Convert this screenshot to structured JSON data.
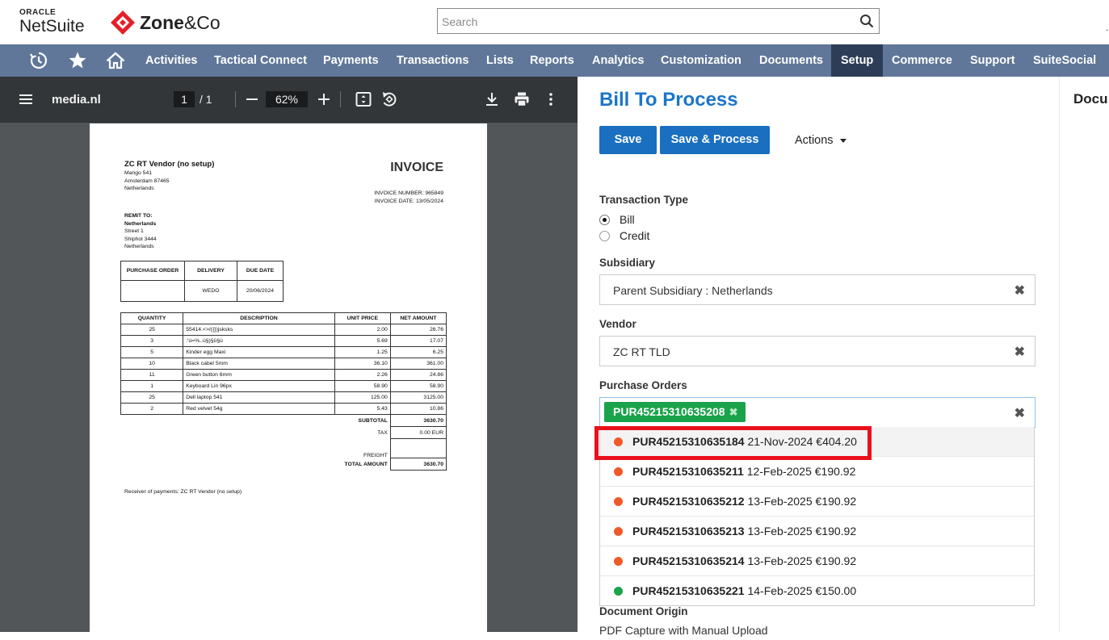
{
  "header": {
    "oracle_text": "ORACLE",
    "netsuite_text": "NetSuite",
    "zone_brand_bold": "Zone",
    "zone_brand_rest": "&Co",
    "search_placeholder": "Search"
  },
  "nav": {
    "icons": [
      "recent-icon",
      "star-icon",
      "home-icon"
    ],
    "items": [
      "Activities",
      "Tactical Connect",
      "Payments",
      "Transactions",
      "Lists",
      "Reports",
      "Analytics",
      "Customization",
      "Documents",
      "Setup",
      "Commerce",
      "Support",
      "SuiteSocial"
    ],
    "active": "Setup",
    "bg_color": "#607799",
    "active_color": "#2e3d57"
  },
  "pdf_viewer": {
    "filename": "media.nl",
    "page_current": "1",
    "page_total": "/ 1",
    "zoom": "62%",
    "invoice": {
      "vendor_name": "ZC RT Vendor (no setup)",
      "vendor_address": [
        "Mango 541",
        "Amsterdam 87465",
        "Netherlands"
      ],
      "title": "INVOICE",
      "invoice_number": "INVOICE NUMBER: 965849",
      "invoice_date": "INVOICE DATE: 13/05/2024",
      "remit_label": "REMIT TO:",
      "remit_name": "Netherlands",
      "remit_address": [
        "Street 1",
        "Shiphol 3444",
        "Netherlands"
      ],
      "po_headers": [
        "PURCHASE ORDER",
        "DELIVERY",
        "DUE DATE"
      ],
      "po_row": [
        "",
        "WEDO",
        "20/06/2024"
      ],
      "item_headers": [
        "QUANTITY",
        "DESCRIPTION",
        "UNIT PRICE",
        "NET AMOUNT"
      ],
      "items": [
        [
          "25",
          "55414.<>/({})jsksks",
          "2.00",
          "26.76"
        ],
        [
          "3",
          ":'ù=%..ù§)§û§ù",
          "5.69",
          "17.07"
        ],
        [
          "5",
          "Kinder egg Maxi",
          "1.25",
          "6.25"
        ],
        [
          "10",
          "Black cabel 5mm",
          "36.10",
          "361.00"
        ],
        [
          "11",
          "Green button 6mm",
          "2.26",
          "24.86"
        ],
        [
          "1",
          "Keyboard Lin 96px",
          "58.90",
          "58.90"
        ],
        [
          "25",
          "Dell laptop 541",
          "125.00",
          "3125.00"
        ],
        [
          "2",
          "Red velvet 54g",
          "5.43",
          "10.86"
        ]
      ],
      "subtotal_label": "SUBTOTAL",
      "subtotal_value": "3630.70",
      "tax_label": "TAX",
      "tax_value": "0.00 EUR",
      "freight_label": "FREIGHT",
      "freight_value": "",
      "total_label": "TOTAL AMOUNT",
      "total_value": "3630.70",
      "receiver": "Receiver of payments: ZC RT Vendor (no setup)"
    }
  },
  "form": {
    "title": "Bill To Process",
    "save_label": "Save",
    "save_process_label": "Save & Process",
    "actions_label": "Actions",
    "transaction_type_label": "Transaction Type",
    "transaction_types": [
      {
        "label": "Bill",
        "selected": true
      },
      {
        "label": "Credit",
        "selected": false
      }
    ],
    "subsidiary_label": "Subsidiary",
    "subsidiary_value": "Parent Subsidiary : Netherlands",
    "vendor_label": "Vendor",
    "vendor_value": "ZC RT TLD",
    "purchase_orders_label": "Purchase Orders",
    "selected_po": "PUR45215310635208",
    "po_options": [
      {
        "id": "PUR45215310635184",
        "details": "21-Nov-2024 €404.20",
        "status_color": "#f05a28",
        "highlighted": true
      },
      {
        "id": "PUR45215310635211",
        "details": "12-Feb-2025 €190.92",
        "status_color": "#f05a28",
        "highlighted": false
      },
      {
        "id": "PUR45215310635212",
        "details": "13-Feb-2025 €190.92",
        "status_color": "#f05a28",
        "highlighted": false
      },
      {
        "id": "PUR45215310635213",
        "details": "13-Feb-2025 €190.92",
        "status_color": "#f05a28",
        "highlighted": false
      },
      {
        "id": "PUR45215310635214",
        "details": "13-Feb-2025 €190.92",
        "status_color": "#f05a28",
        "highlighted": false
      },
      {
        "id": "PUR45215310635221",
        "details": "14-Feb-2025 €150.00",
        "status_color": "#1aa34a",
        "highlighted": false
      }
    ],
    "document_origin_label": "Document Origin",
    "document_origin_value": "PDF Capture with Manual Upload"
  },
  "right_pane": {
    "title": "Docu"
  },
  "accent_colors": {
    "primary_button": "#1a6fc0",
    "title": "#1c76c8",
    "highlight_box": "#e9111d",
    "tag": "#1aa34a"
  }
}
